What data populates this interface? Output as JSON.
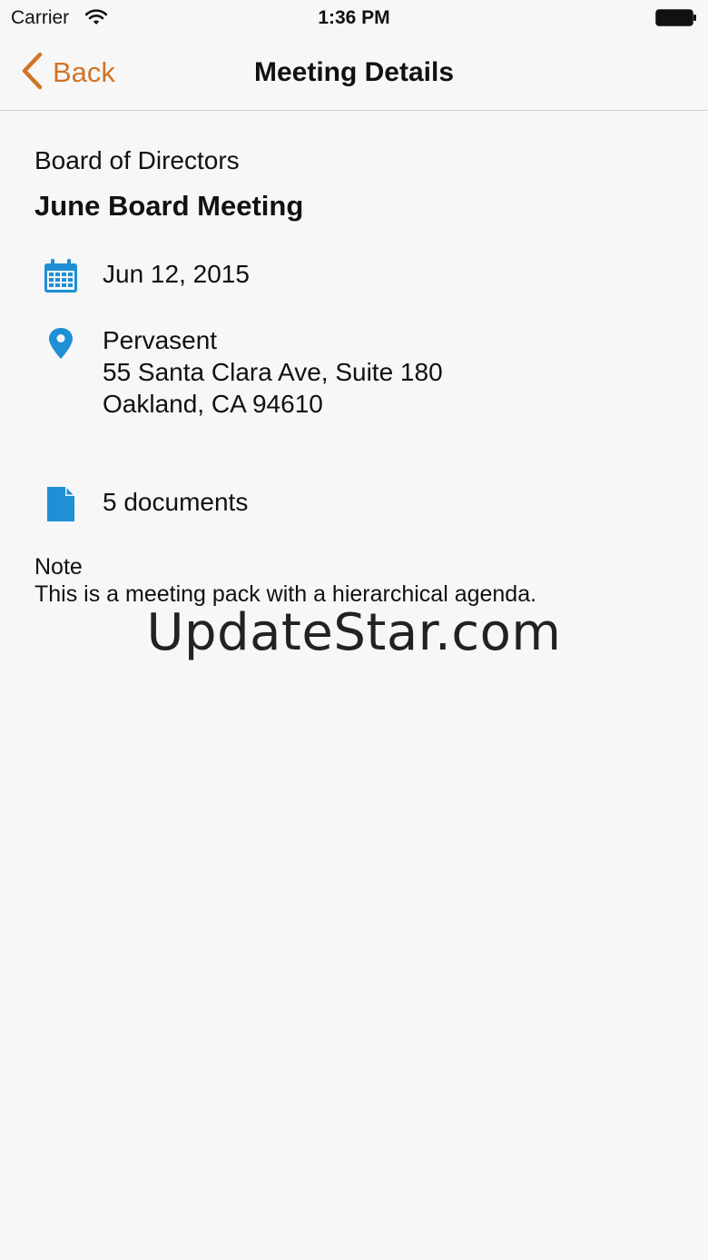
{
  "status_bar": {
    "carrier": "Carrier",
    "time": "1:36 PM",
    "icons": [
      "wifi-icon",
      "battery-icon"
    ]
  },
  "nav": {
    "back_label": "Back",
    "title": "Meeting Details",
    "back_icon": "chevron-left-icon"
  },
  "meeting": {
    "group": "Board of Directors",
    "title": "June Board Meeting",
    "date": "Jun 12, 2015",
    "location": {
      "name": "Pervasent",
      "address_line1": "55 Santa Clara Ave, Suite 180",
      "address_line2": "Oakland, CA 94610"
    },
    "documents": "5 documents",
    "note_label": "Note",
    "note_text": "This is a meeting pack with a hierarchical agenda."
  },
  "watermark": "UpdateStar.com",
  "colors": {
    "accent": "#d07427",
    "icon_blue": "#1f8fd6",
    "background": "#f7f7f7"
  }
}
